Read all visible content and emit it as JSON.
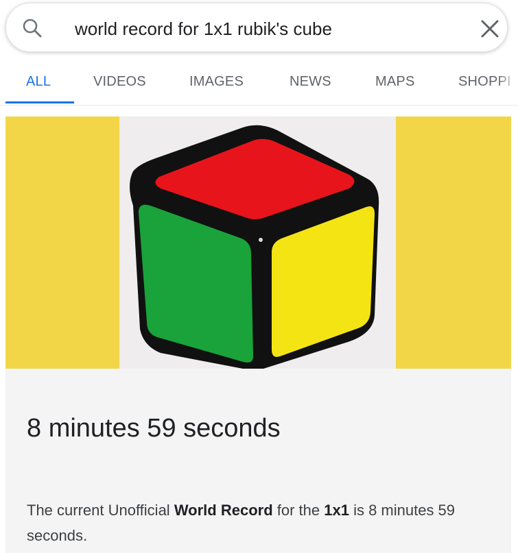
{
  "search": {
    "query": "world record for 1x1 rubik's cube",
    "search_icon": "search-icon",
    "clear_icon": "close-icon"
  },
  "tabs": [
    {
      "label": "ALL",
      "active": true
    },
    {
      "label": "VIDEOS",
      "active": false
    },
    {
      "label": "IMAGES",
      "active": false
    },
    {
      "label": "NEWS",
      "active": false
    },
    {
      "label": "MAPS",
      "active": false
    },
    {
      "label": "SHOPPI",
      "active": false
    }
  ],
  "featured_image": {
    "subject": "1x1 rubik's cube",
    "background_color": "#f3d648",
    "face_colors": {
      "top": "#e8141b",
      "left": "#19a33a",
      "right": "#f5e414",
      "body": "#111111"
    }
  },
  "result": {
    "answer": "8 minutes 59 seconds",
    "snippet_parts": [
      {
        "text": "The current Unofficial ",
        "bold": false
      },
      {
        "text": "World Record",
        "bold": true
      },
      {
        "text": " for the ",
        "bold": false
      },
      {
        "text": "1x1",
        "bold": true
      },
      {
        "text": " is 8 minutes 59 seconds.",
        "bold": false
      }
    ]
  },
  "colors": {
    "accent": "#1a73e8",
    "tab_text": "#5f6368",
    "card_bg": "#f4f4f5"
  }
}
